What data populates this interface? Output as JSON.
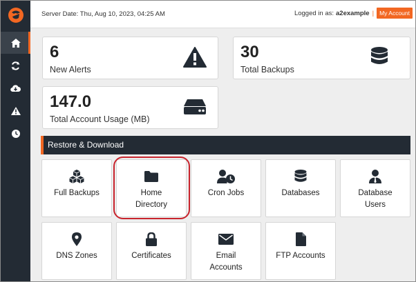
{
  "topbar": {
    "server_date": "Server Date: Thu, Aug 10, 2023, 04:25 AM",
    "logged_in_prefix": "Logged in as:",
    "username": "a2example",
    "separator": "|",
    "my_account": "My Account"
  },
  "sidebar": {
    "items": [
      {
        "icon": "home-icon",
        "active": true
      },
      {
        "icon": "refresh-icon",
        "active": false
      },
      {
        "icon": "cloud-download-icon",
        "active": false
      },
      {
        "icon": "warning-icon",
        "active": false
      },
      {
        "icon": "clock-icon",
        "active": false
      }
    ]
  },
  "stats": {
    "alerts": {
      "value": "6",
      "label": "New Alerts",
      "icon": "warning-icon"
    },
    "backups": {
      "value": "30",
      "label": "Total Backups",
      "icon": "database-icon"
    },
    "usage": {
      "value": "147.0",
      "label": "Total Account Usage (MB)",
      "icon": "hard-drive-icon"
    }
  },
  "section": {
    "title": "Restore & Download"
  },
  "tiles": [
    {
      "line1": "Full Backups",
      "line2": "",
      "icon": "cubes-icon"
    },
    {
      "line1": "Home",
      "line2": "Directory",
      "icon": "folder-icon"
    },
    {
      "line1": "Cron Jobs",
      "line2": "",
      "icon": "user-clock-icon"
    },
    {
      "line1": "Databases",
      "line2": "",
      "icon": "database-icon"
    },
    {
      "line1": "Database",
      "line2": "Users",
      "icon": "user-tie-icon"
    },
    {
      "line1": "DNS Zones",
      "line2": "",
      "icon": "map-marker-icon"
    },
    {
      "line1": "Certificates",
      "line2": "",
      "icon": "lock-icon"
    },
    {
      "line1": "Email",
      "line2": "Accounts",
      "icon": "envelope-icon"
    },
    {
      "line1": "FTP Accounts",
      "line2": "",
      "icon": "file-icon"
    }
  ],
  "colors": {
    "accent": "#f26722",
    "sidebar": "#232b34",
    "highlight": "#c8232c"
  }
}
